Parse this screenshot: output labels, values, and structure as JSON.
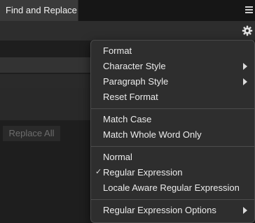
{
  "panel": {
    "tab_title": "Find and Replace",
    "replace_all_label": "Replace All"
  },
  "icons": {
    "menu": "hamburger-icon",
    "settings": "gear-icon",
    "submenu": "chevron-right-icon",
    "checked": "checkmark-icon"
  },
  "menu": {
    "items": [
      {
        "label": "Format"
      },
      {
        "label": "Character Style",
        "submenu": true
      },
      {
        "label": "Paragraph Style",
        "submenu": true
      },
      {
        "label": "Reset Format"
      },
      {
        "label": "Match Case"
      },
      {
        "label": "Match Whole Word Only"
      },
      {
        "label": "Normal"
      },
      {
        "label": "Regular Expression",
        "checked": true
      },
      {
        "label": "Locale Aware Regular Expression"
      },
      {
        "label": "Regular Expression Options",
        "submenu": true
      }
    ]
  }
}
